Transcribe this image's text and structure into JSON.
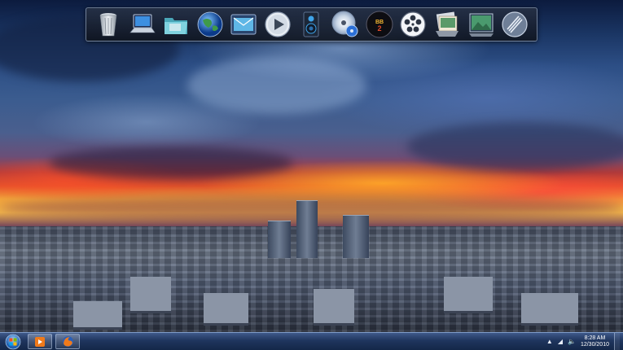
{
  "dock": {
    "items": [
      {
        "name": "recycle-bin-icon"
      },
      {
        "name": "computer-icon"
      },
      {
        "name": "folder-icon"
      },
      {
        "name": "internet-globe-icon"
      },
      {
        "name": "mail-icon"
      },
      {
        "name": "media-play-icon"
      },
      {
        "name": "speaker-icon"
      },
      {
        "name": "dvd-disc-icon"
      },
      {
        "name": "game-app-icon"
      },
      {
        "name": "film-reel-icon"
      },
      {
        "name": "photo-stack-icon"
      },
      {
        "name": "picture-frame-icon"
      },
      {
        "name": "steam-app-icon"
      }
    ]
  },
  "taskbar": {
    "pinned": [
      {
        "name": "media-player-icon"
      },
      {
        "name": "firefox-icon"
      }
    ],
    "clock": {
      "time": "8:28 AM",
      "date": "12/30/2010"
    },
    "tray": [
      {
        "name": "show-hidden-icons-icon",
        "glyph": "▲"
      },
      {
        "name": "network-icon",
        "glyph": "◢"
      },
      {
        "name": "volume-icon",
        "glyph": "🔈"
      }
    ]
  },
  "colors": {
    "taskbar_top": "#3f5a8a",
    "taskbar_bottom": "#142748",
    "start_orb": "#2a8be0"
  }
}
